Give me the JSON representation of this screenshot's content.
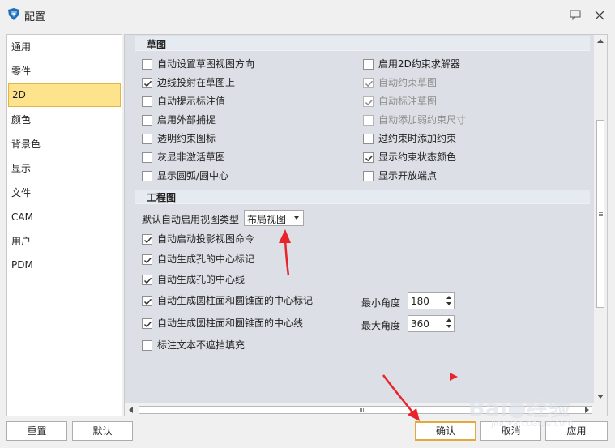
{
  "window": {
    "title": "配置",
    "icons": [
      "app-icon",
      "chat-icon",
      "close-icon"
    ]
  },
  "sidebar": {
    "items": [
      {
        "label": "通用"
      },
      {
        "label": "零件"
      },
      {
        "label": "2D",
        "selected": true
      },
      {
        "label": "颜色"
      },
      {
        "label": "背景色"
      },
      {
        "label": "显示"
      },
      {
        "label": "文件"
      },
      {
        "label": "CAM"
      },
      {
        "label": "用户"
      },
      {
        "label": "PDM"
      }
    ]
  },
  "sketch": {
    "title": "草图",
    "options_left": [
      {
        "label": "自动设置草图视图方向",
        "checked": false
      },
      {
        "label": "边线投射在草图上",
        "checked": true
      },
      {
        "label": "自动提示标注值",
        "checked": false
      },
      {
        "label": "启用外部捕捉",
        "checked": false
      },
      {
        "label": "透明约束图标",
        "checked": false
      },
      {
        "label": "灰显非激活草图",
        "checked": false
      },
      {
        "label": "显示圆弧/圆中心",
        "checked": false
      }
    ],
    "options_right": [
      {
        "label": "启用2D约束求解器",
        "checked": false,
        "disabled": false
      },
      {
        "label": "自动约束草图",
        "checked": true,
        "disabled": true
      },
      {
        "label": "自动标注草图",
        "checked": true,
        "disabled": true
      },
      {
        "label": "自动添加弱约束尺寸",
        "checked": false,
        "disabled": true
      },
      {
        "label": "过约束时添加约束",
        "checked": false,
        "disabled": false
      },
      {
        "label": "显示约束状态颜色",
        "checked": true,
        "disabled": false
      },
      {
        "label": "显示开放端点",
        "checked": false,
        "disabled": false
      }
    ]
  },
  "drawing": {
    "title": "工程图",
    "view_type_label": "默认自动启用视图类型",
    "view_type_value": "布局视图",
    "options": [
      {
        "label": "自动启动投影视图命令",
        "checked": true
      },
      {
        "label": "自动生成孔的中心标记",
        "checked": true
      },
      {
        "label": "自动生成孔的中心线",
        "checked": true
      },
      {
        "label": "自动生成圆柱面和圆锥面的中心标记",
        "checked": true
      },
      {
        "label": "自动生成圆柱面和圆锥面的中心线",
        "checked": true
      },
      {
        "label": "标注文本不遮挡填充",
        "checked": false
      }
    ],
    "min_angle_label": "最小角度",
    "min_angle_value": "180",
    "max_angle_label": "最大角度",
    "max_angle_value": "360"
  },
  "buttons": {
    "reset": "重置",
    "default": "默认",
    "ok": "确认",
    "cancel": "取消",
    "apply": "应用"
  },
  "watermark": {
    "text": "Bai",
    "text2": "经验",
    "sub": "jingyan.baidu.com"
  },
  "colors": {
    "selected_nav_bg": "#fde38b",
    "primary_button_border": "#e3a93a",
    "annotation_arrow": "#e8232a"
  }
}
